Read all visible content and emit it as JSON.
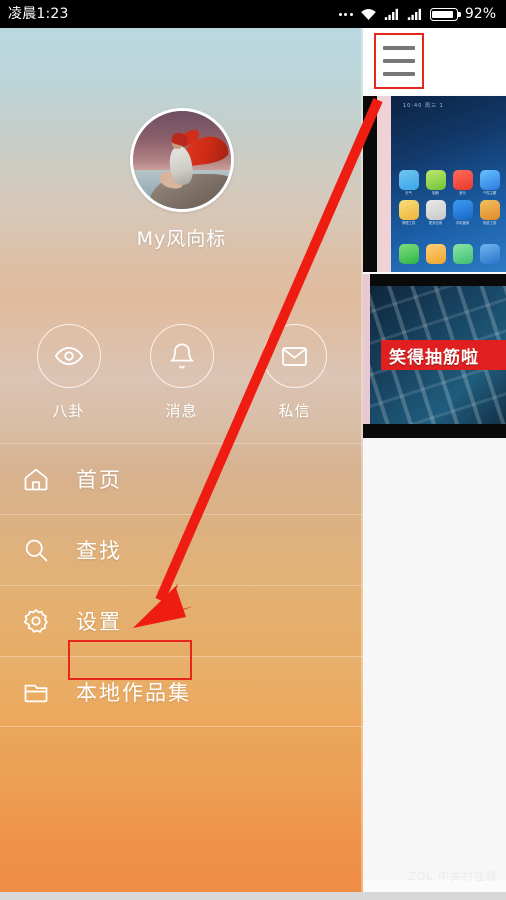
{
  "statusbar": {
    "time": "凌晨1:23",
    "battery_pct": "92%",
    "icons": [
      "more-dots",
      "wifi",
      "signal-1",
      "signal-2",
      "battery"
    ]
  },
  "right_panel": {
    "menu_button": {
      "icon": "hamburger-icon",
      "highlighted": true
    },
    "thumbnails": [
      {
        "name": "phone-home-screen-thumbnail",
        "status_text": "10:40 周三 1",
        "app_labels": [
          "天气",
          "相册",
          "音乐",
          "个性主题",
          "清理工具",
          "更多应用",
          "手机管家",
          "系统工具"
        ],
        "page_dots": "• •"
      },
      {
        "name": "video-thumbnail",
        "banner_text": "笑得抽筋啦"
      }
    ],
    "watermark": "ZOL 中关村在线"
  },
  "drawer": {
    "profile": {
      "avatar_alt": "用户头像",
      "username": "My风向标"
    },
    "actions": [
      {
        "icon": "eye-icon",
        "label": "八卦"
      },
      {
        "icon": "bell-icon",
        "label": "消息"
      },
      {
        "icon": "envelope-icon",
        "label": "私信"
      }
    ],
    "menu": [
      {
        "icon": "home-icon",
        "label": "首页",
        "active": false
      },
      {
        "icon": "search-icon",
        "label": "查找",
        "active": false
      },
      {
        "icon": "gear-icon",
        "label": "设置",
        "active": false
      },
      {
        "icon": "folder-icon",
        "label": "本地作品集",
        "active": true
      }
    ]
  },
  "annotations": {
    "arrow": {
      "name": "red-pointer-arrow",
      "from": "hamburger menu button",
      "to": "本地作品集"
    },
    "highlight_color": "#e8271c"
  }
}
